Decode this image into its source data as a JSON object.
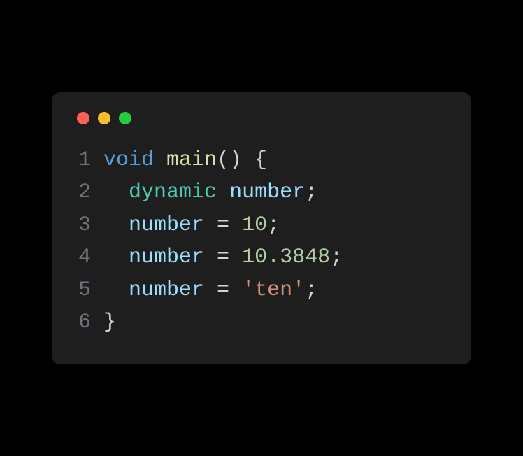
{
  "traffic_lights": {
    "red": "#ff5f56",
    "yellow": "#ffbd2e",
    "green": "#27c93f"
  },
  "code": {
    "lines": [
      {
        "n": "1",
        "tokens": [
          {
            "cls": "kw-void",
            "t": "void"
          },
          {
            "cls": "plain",
            "t": " "
          },
          {
            "cls": "fn",
            "t": "main"
          },
          {
            "cls": "plain",
            "t": "() {"
          }
        ]
      },
      {
        "n": "2",
        "tokens": [
          {
            "cls": "plain",
            "t": "  "
          },
          {
            "cls": "kw-dyn",
            "t": "dynamic"
          },
          {
            "cls": "plain",
            "t": " "
          },
          {
            "cls": "ident",
            "t": "number"
          },
          {
            "cls": "plain",
            "t": ";"
          }
        ]
      },
      {
        "n": "3",
        "tokens": [
          {
            "cls": "plain",
            "t": "  "
          },
          {
            "cls": "ident",
            "t": "number"
          },
          {
            "cls": "plain",
            "t": " = "
          },
          {
            "cls": "num",
            "t": "10"
          },
          {
            "cls": "plain",
            "t": ";"
          }
        ]
      },
      {
        "n": "4",
        "tokens": [
          {
            "cls": "plain",
            "t": "  "
          },
          {
            "cls": "ident",
            "t": "number"
          },
          {
            "cls": "plain",
            "t": " = "
          },
          {
            "cls": "num",
            "t": "10.3848"
          },
          {
            "cls": "plain",
            "t": ";"
          }
        ]
      },
      {
        "n": "5",
        "tokens": [
          {
            "cls": "plain",
            "t": "  "
          },
          {
            "cls": "ident",
            "t": "number"
          },
          {
            "cls": "plain",
            "t": " = "
          },
          {
            "cls": "str",
            "t": "'ten'"
          },
          {
            "cls": "plain",
            "t": ";"
          }
        ]
      },
      {
        "n": "6",
        "tokens": [
          {
            "cls": "plain",
            "t": "}"
          }
        ]
      }
    ]
  }
}
